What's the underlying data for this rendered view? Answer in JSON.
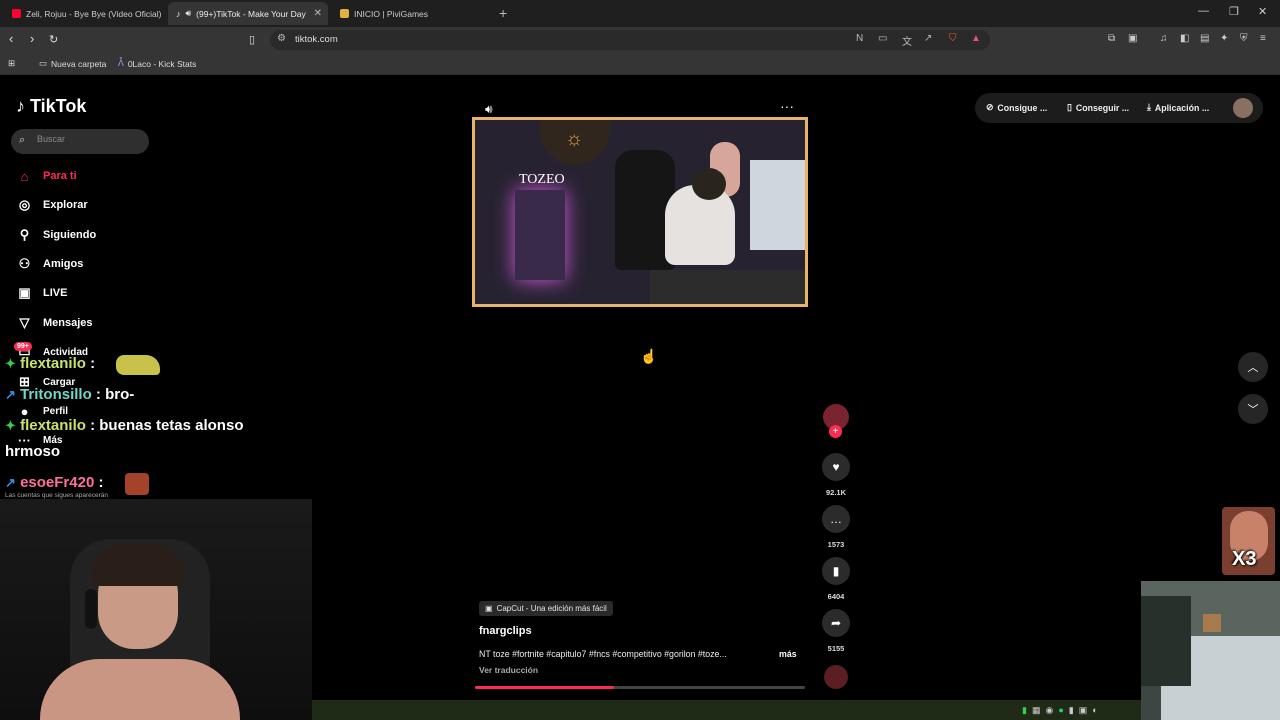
{
  "browser": {
    "tabs": [
      {
        "title": "Zeli, Rojuu - Bye Bye (Video Oficial)",
        "favicon_color": "#ff0033",
        "active": false
      },
      {
        "title": "(99+)TikTok - Make Your Day",
        "favicon_color": "#ffffff",
        "active": true
      },
      {
        "title": "INICIO | PiviGames",
        "favicon_color": "#e0b040",
        "active": false
      }
    ],
    "new_tab_icon": "+",
    "url": "tiktok.com",
    "bookmarks": [
      {
        "label": "Nueva carpeta",
        "icon": "folder-icon"
      },
      {
        "label": "0Laco - Kick Stats",
        "icon": "kick-stats-icon"
      }
    ]
  },
  "tiktok": {
    "brand": "TikTok",
    "accent": "#fe2c55",
    "search_placeholder": "Buscar",
    "nav": [
      {
        "label": "Para ti",
        "icon": "home-icon",
        "active": true
      },
      {
        "label": "Explorar",
        "icon": "compass-icon",
        "active": false
      },
      {
        "label": "Siguiendo",
        "icon": "following-icon",
        "active": false
      },
      {
        "label": "Amigos",
        "icon": "friends-icon",
        "active": false
      },
      {
        "label": "LIVE",
        "icon": "live-icon",
        "active": false
      },
      {
        "label": "Mensajes",
        "icon": "messages-icon",
        "active": false
      },
      {
        "label": "Actividad",
        "icon": "activity-icon",
        "active": false
      },
      {
        "label": "Cargar",
        "icon": "upload-icon",
        "active": false
      },
      {
        "label": "Perfil",
        "icon": "profile-icon",
        "active": false
      },
      {
        "label": "Más",
        "icon": "more-icon",
        "active": false
      }
    ],
    "activity_badge": "99+",
    "follow_hint": "Las cuentas que sigues aparecerán",
    "top_right": [
      {
        "label": "Consigue ...",
        "icon": "coin-icon"
      },
      {
        "label": "Conseguir ...",
        "icon": "phone-icon"
      },
      {
        "label": "Aplicación ...",
        "icon": "download-icon"
      }
    ],
    "video": {
      "overlay_text": "TOZEO",
      "caption_tag": "CapCut - Una edición más fácil",
      "author": "fnargclips",
      "description": "NT toze #fortnite #capitulo7 #fncs #competitivo #gorilon #toze...",
      "more": "más",
      "translate": "Ver traducción",
      "progress_percent": 42,
      "likes": "92.1K",
      "comments": "1573",
      "saves": "6404",
      "shares": "5155"
    }
  },
  "stream_overlay": {
    "chat": [
      {
        "user": "flextanilo",
        "message": "",
        "user_color": "#c9e36a"
      },
      {
        "user": "Tritonsillo",
        "message": ": bro-",
        "user_color": "#6fd7c9"
      },
      {
        "user": "flextanilo",
        "message": ": buenas tetas alonso",
        "continuation": "hrmoso",
        "user_color": "#c9e36a"
      },
      {
        "user": "esoeFr420",
        "message": ":",
        "user_color": "#ff6f9a"
      }
    ],
    "chat_separator": ":",
    "meme_counter": "X3"
  }
}
